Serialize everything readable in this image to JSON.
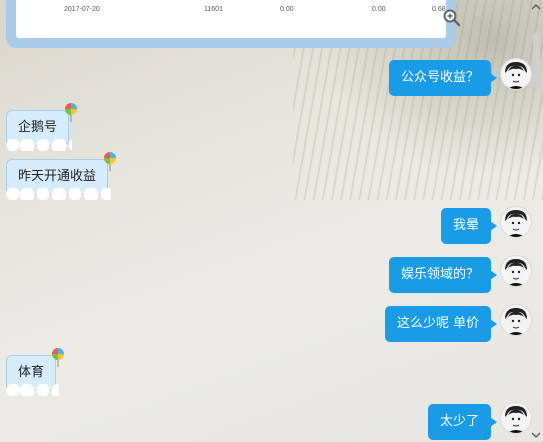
{
  "image_preview": {
    "row": [
      "2017-07-20",
      "11601",
      "0.00",
      "0.00",
      "0.68"
    ],
    "zoom_icon": "zoom-in-icon"
  },
  "messages": [
    {
      "side": "out",
      "text": "公众号收益？"
    },
    {
      "side": "in",
      "text": "企鹅号"
    },
    {
      "side": "in",
      "text": "昨天开通收益"
    },
    {
      "side": "out",
      "text": "我晕"
    },
    {
      "side": "out",
      "text": "娱乐领域的？"
    },
    {
      "side": "out",
      "text": "这么少呢 单价"
    },
    {
      "side": "in",
      "text": "体育"
    },
    {
      "side": "out",
      "text": "太少了"
    }
  ],
  "colors": {
    "outgoing_bubble": "#1a9be6",
    "incoming_bubble": "#d7ecfb",
    "image_frame": "#aacbea"
  },
  "icons": {
    "avatar": "user-avatar",
    "bubble_decoration": "balloon-icon",
    "scroll_up": "chevron-up-icon",
    "scroll_down": "chevron-down-icon"
  }
}
